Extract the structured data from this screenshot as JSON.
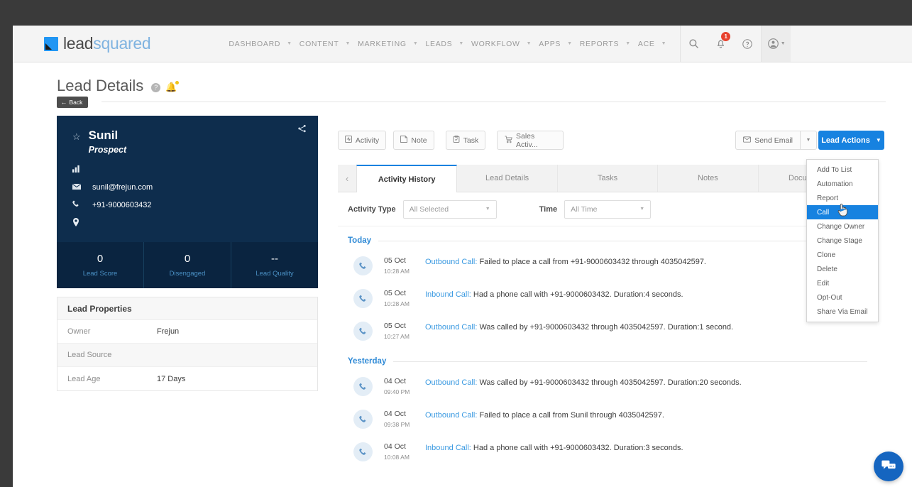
{
  "brand": {
    "lead": "lead",
    "squared": "squared"
  },
  "topnav": {
    "items": [
      {
        "label": "DASHBOARD",
        "caret": "▼"
      },
      {
        "label": "CONTENT",
        "caret": "▼"
      },
      {
        "label": "MARKETING",
        "caret": "▼"
      },
      {
        "label": "LEADS",
        "caret": "▼"
      },
      {
        "label": "WORKFLOW",
        "caret": "▼"
      },
      {
        "label": "APPS",
        "caret": "▼"
      },
      {
        "label": "REPORTS",
        "caret": "▼"
      },
      {
        "label": "ACE",
        "caret": "▼"
      }
    ],
    "search_icon": "search-icon",
    "bell_icon": "notification-bell-icon",
    "notification_count": "1",
    "help_icon": "help-circle-icon",
    "profile_icon": "user-account-icon",
    "profile_caret": "▼"
  },
  "page": {
    "title": "Lead Details",
    "help_glyph": "?",
    "bell_glyph": "🔔",
    "back_label": "Back",
    "back_arrow": "←"
  },
  "lead_card": {
    "star_glyph": "☆",
    "share_glyph": "⸭",
    "name": "Sunil",
    "stage": "Prospect",
    "fields": [
      {
        "icon": "chart-bar-icon",
        "glyph": "█",
        "value": ""
      },
      {
        "icon": "email-icon",
        "glyph": "✉",
        "value": "sunil@frejun.com"
      },
      {
        "icon": "phone-icon",
        "glyph": "☎",
        "value": "+91-9000603432"
      },
      {
        "icon": "location-pin-icon",
        "glyph": "●",
        "value": ""
      }
    ],
    "stats": [
      {
        "value": "0",
        "label": "Lead Score"
      },
      {
        "value": "0",
        "label": "Disengaged"
      },
      {
        "value": "--",
        "label": "Lead Quality"
      }
    ]
  },
  "lead_properties": {
    "heading": "Lead Properties",
    "rows": [
      {
        "key": "Owner",
        "value": "Frejun"
      },
      {
        "key": "Lead Source",
        "value": ""
      },
      {
        "key": "Lead Age",
        "value": "17 Days"
      }
    ]
  },
  "toolbar": {
    "buttons": [
      {
        "label": "Activity",
        "icon": "activity-icon",
        "glyph": "▣"
      },
      {
        "label": "Note",
        "icon": "note-icon",
        "glyph": "◱"
      },
      {
        "label": "Task",
        "icon": "task-icon",
        "glyph": "☑"
      },
      {
        "label": "Sales Activ...",
        "icon": "sales-cart-icon",
        "glyph": "⛁"
      }
    ],
    "send_email_label": "Send Email",
    "send_email_icon": "envelope-icon",
    "send_email_glyph": "✉",
    "send_email_caret": "▼",
    "lead_actions_label": "Lead Actions",
    "lead_actions_caret": "▼"
  },
  "lead_actions_menu": {
    "items": [
      {
        "label": "Add To List",
        "active": false
      },
      {
        "label": "Automation",
        "active": false
      },
      {
        "label": "Report",
        "active": false
      },
      {
        "label": "Call",
        "active": true
      },
      {
        "label": "Change Owner",
        "active": false
      },
      {
        "label": "Change Stage",
        "active": false
      },
      {
        "label": "Clone",
        "active": false
      },
      {
        "label": "Delete",
        "active": false
      },
      {
        "label": "Edit",
        "active": false
      },
      {
        "label": "Opt-Out",
        "active": false
      },
      {
        "label": "Share Via Email",
        "active": false
      }
    ],
    "cursor_glyph": "☝"
  },
  "tabs": {
    "left_arrow": "‹",
    "right_arrow": "›",
    "items": [
      {
        "label": "Activity History",
        "active": true
      },
      {
        "label": "Lead Details",
        "active": false
      },
      {
        "label": "Tasks",
        "active": false
      },
      {
        "label": "Notes",
        "active": false
      },
      {
        "label": "Documents",
        "active": false
      }
    ]
  },
  "filters": {
    "activity_type_label": "Activity Type",
    "activity_type_value": "All Selected",
    "time_label": "Time",
    "time_value": "All Time",
    "caret": "▼"
  },
  "activity_groups": [
    {
      "day": "Today",
      "rows": [
        {
          "icon": "phone-call-icon",
          "glyph": "☎",
          "date": "05 Oct",
          "time": "10:28 AM",
          "type": "Outbound Call:",
          "text": " Failed to place a call from +91-9000603432 through 4035042597."
        },
        {
          "icon": "phone-call-icon",
          "glyph": "☎",
          "date": "05 Oct",
          "time": "10:28 AM",
          "type": "Inbound Call:",
          "text": " Had a phone call with +91-9000603432. Duration:4 seconds."
        },
        {
          "icon": "phone-call-icon",
          "glyph": "☎",
          "date": "05 Oct",
          "time": "10:27 AM",
          "type": "Outbound Call:",
          "text": " Was called by +91-9000603432 through 4035042597. Duration:1 second."
        }
      ]
    },
    {
      "day": "Yesterday",
      "rows": [
        {
          "icon": "phone-call-icon",
          "glyph": "☎",
          "date": "04 Oct",
          "time": "09:40 PM",
          "type": "Outbound Call:",
          "text": " Was called by +91-9000603432 through 4035042597. Duration:20 seconds."
        },
        {
          "icon": "phone-call-icon",
          "glyph": "☎",
          "date": "04 Oct",
          "time": "09:38 PM",
          "type": "Outbound Call:",
          "text": " Failed to place a call from Sunil through 4035042597."
        },
        {
          "icon": "phone-call-icon",
          "glyph": "☎",
          "date": "04 Oct",
          "time": "10:08 AM",
          "type": "Inbound Call:",
          "text": " Had a phone call with +91-9000603432. Duration:3 seconds."
        }
      ]
    }
  ],
  "chat_widget": {
    "icon": "chat-bubbles-icon"
  },
  "colors": {
    "accent_blue": "#1782e0",
    "card_navy": "#0e2d4d",
    "link_blue": "#3b9ae1",
    "badge_red": "#e8422e"
  }
}
